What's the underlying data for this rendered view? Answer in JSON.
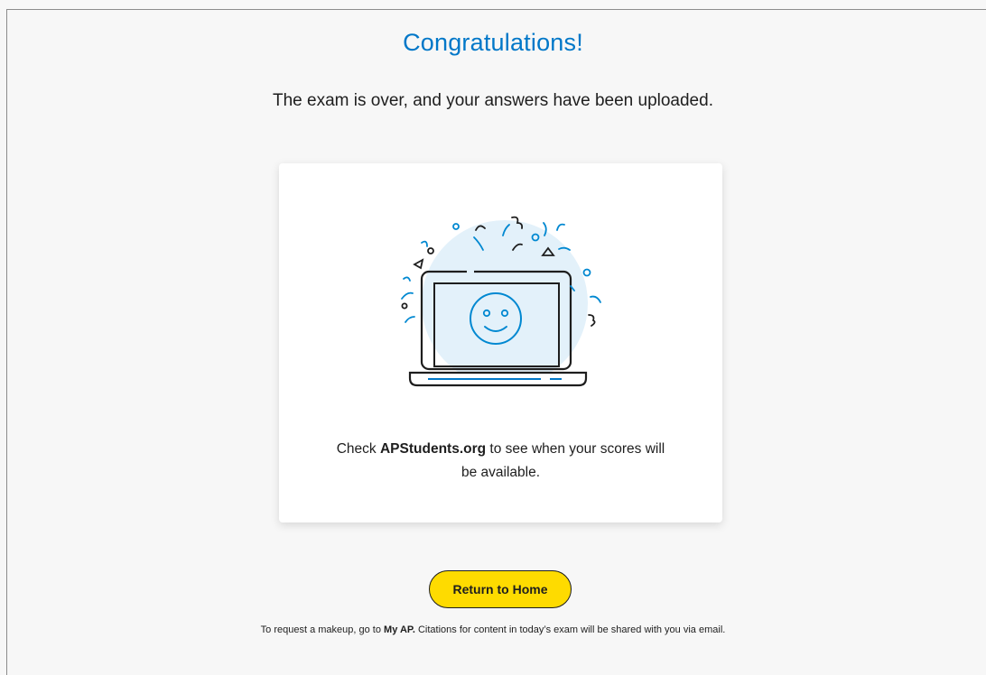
{
  "page": {
    "title": "Congratulations!",
    "subtitle": "The exam is over, and your answers have been uploaded."
  },
  "card": {
    "message_prefix": "Check ",
    "message_link": "APStudents.org",
    "message_suffix": " to see when your scores will be available."
  },
  "actions": {
    "return_home_label": "Return to Home"
  },
  "footer": {
    "prefix": "To request a makeup, go to ",
    "link": "My AP.",
    "suffix": " Citations for content in today’s exam will be shared with you via email."
  },
  "colors": {
    "accent_blue": "#0077c8",
    "button_yellow": "#fedb00",
    "illustration_circle": "#e3f1fa"
  },
  "icons": [
    "laptop-smiley-icon",
    "confetti-decoration"
  ]
}
